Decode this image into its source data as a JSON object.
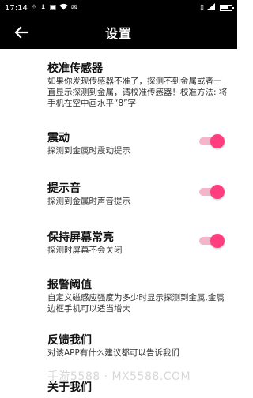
{
  "status_bar": {
    "time": "17:14",
    "left_icons": [
      "warning-icon",
      "download-icon",
      "image-icon",
      "wifi-icon",
      "message-icon"
    ],
    "right_icons": [
      "vibrate-icon",
      "signal-icon",
      "battery-icon"
    ]
  },
  "appbar": {
    "title": "设置",
    "back_icon": "arrow-left-icon"
  },
  "settings": {
    "calibrate": {
      "title": "校准传感器",
      "desc": "如果你发现传感器不准了，探测不到金属或者一直显示探测到金属，请校准传感器！校准方法: 将手机在空中画水平“8”字"
    },
    "vibrate": {
      "title": "震动",
      "desc": "探测到金属时震动提示",
      "enabled": true
    },
    "sound": {
      "title": "提示音",
      "desc": "探测到金属时声音提示",
      "enabled": true
    },
    "keep_screen": {
      "title": "保持屏幕常亮",
      "desc": "探测时屏幕不会关闭",
      "enabled": true
    },
    "threshold": {
      "title": "报警阈值",
      "desc": "自定义磁感应强度为多少时显示探测到金属,金属边框手机可以适当增大"
    },
    "feedback": {
      "title": "反馈我们",
      "desc": "对该APP有什么建议都可以告诉我们"
    },
    "about": {
      "title": "关于我们"
    }
  },
  "watermark": "手游5588 · MX5588.COM",
  "colors": {
    "accent": "#ff3d7f",
    "accent_track": "#f6b4cb",
    "bar": "#000000"
  }
}
